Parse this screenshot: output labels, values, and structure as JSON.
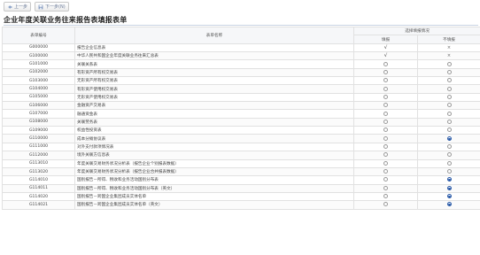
{
  "toolbar": {
    "prev_label": "上一步",
    "next_label": "下一步(N)"
  },
  "title": "企业年度关联业务往来报告表填报表单",
  "table": {
    "headers": {
      "code": "表单编号",
      "name": "表单名称",
      "choose": "选择填报情况",
      "fill": "填报",
      "nofill": "不填报"
    },
    "rows": [
      {
        "code": "G000000",
        "name": "报告企业信息表",
        "state": "fixed"
      },
      {
        "code": "G100000",
        "name": "中华人民共和国企业年度关联业务往来汇总表",
        "state": "fixed"
      },
      {
        "code": "G101000",
        "name": "关联关系表",
        "state": "none"
      },
      {
        "code": "G102000",
        "name": "有形资产所有权交易表",
        "state": "none"
      },
      {
        "code": "G103000",
        "name": "无形资产所有权交易表",
        "state": "none"
      },
      {
        "code": "G104000",
        "name": "有形资产使用权交易表",
        "state": "none"
      },
      {
        "code": "G105000",
        "name": "无形资产使用权交易表",
        "state": "none"
      },
      {
        "code": "G106000",
        "name": "金融资产交易表",
        "state": "none"
      },
      {
        "code": "G107000",
        "name": "融通资金表",
        "state": "none"
      },
      {
        "code": "G108000",
        "name": "关联劳务表",
        "state": "none"
      },
      {
        "code": "G109000",
        "name": "权益性投资表",
        "state": "none"
      },
      {
        "code": "G110000",
        "name": "成本分摊协议表",
        "state": "nofill"
      },
      {
        "code": "G111000",
        "name": "对外支付款项情况表",
        "state": "none"
      },
      {
        "code": "G112000",
        "name": "境外关联方信息表",
        "state": "none"
      },
      {
        "code": "G113010",
        "name": "年度关联交易财务状况分析表（报告企业个别报表数据）",
        "state": "none"
      },
      {
        "code": "G113020",
        "name": "年度关联交易财务状况分析表（报告企业合并报表数据）",
        "state": "none"
      },
      {
        "code": "G114010",
        "name": "国别报告－所得、税收和业务活动国别分布表",
        "state": "nofill"
      },
      {
        "code": "G114011",
        "name": "国别报告－所得、税收和业务活动国别分布表（英文）",
        "state": "nofill"
      },
      {
        "code": "G114020",
        "name": "国别报告－跨国企业集团成员实体名单",
        "state": "nofill"
      },
      {
        "code": "G114021",
        "name": "国别报告－跨国企业集团成员实体名单（英文）",
        "state": "nofill"
      }
    ]
  },
  "icons": {
    "prev": "back-arrow-icon",
    "next": "save-disk-icon",
    "fixed_fill": "checkmark-icon",
    "fixed_nofill": "cross-icon"
  },
  "colors": {
    "radio_selected": "#2a5aa8",
    "title_rule": "#c9d3e3"
  }
}
